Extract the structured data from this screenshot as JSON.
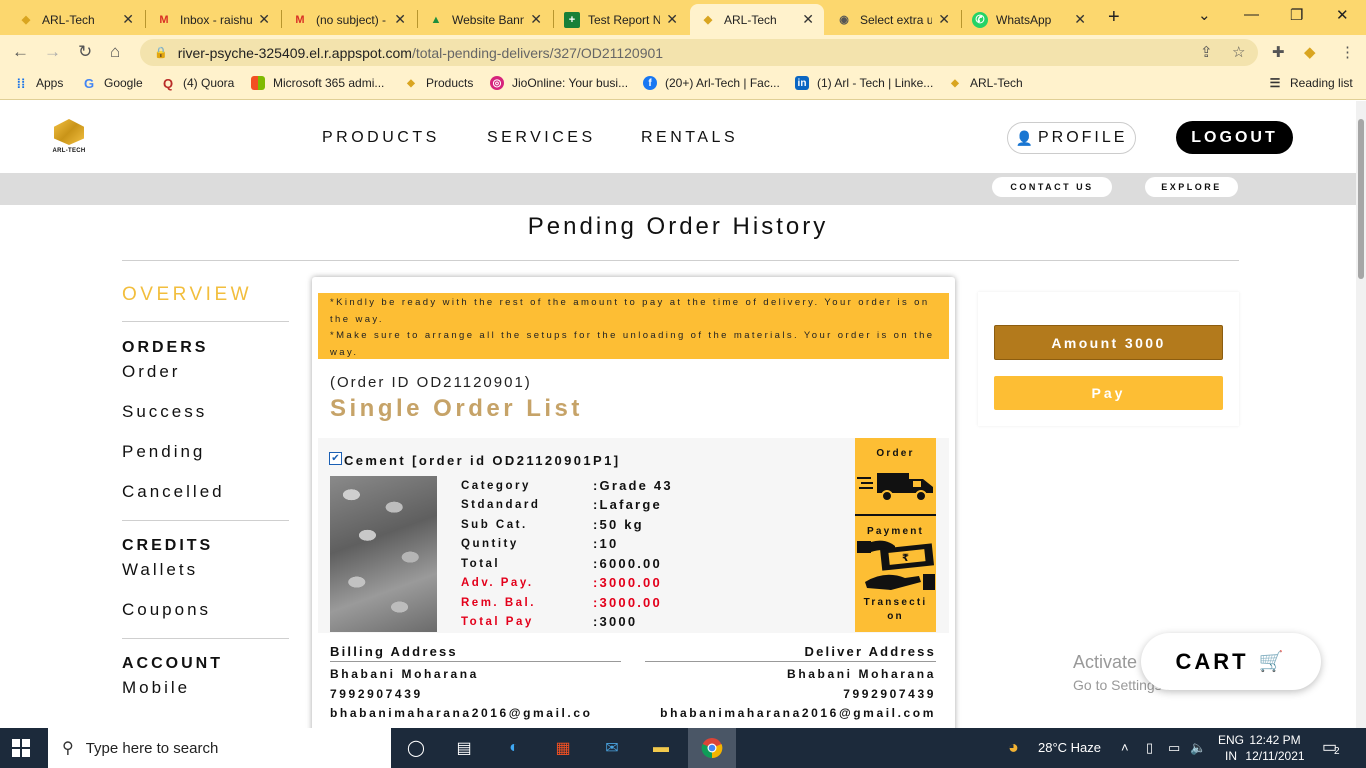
{
  "browser": {
    "tabs": [
      {
        "title": "ARL-Tech",
        "icon": "arl-logo-icon",
        "color": "#d9a520"
      },
      {
        "title": "Inbox - raishu",
        "icon": "gmail-icon",
        "color": "#d93025"
      },
      {
        "title": "(no subject) -",
        "icon": "gmail-icon",
        "color": "#d93025"
      },
      {
        "title": "Website Bann",
        "icon": "google-drive-icon",
        "color": "#1e8e3e"
      },
      {
        "title": "Test Report N",
        "icon": "google-sheets-icon",
        "color": "#188038"
      },
      {
        "title": "ARL-Tech",
        "icon": "arl-logo-icon",
        "color": "#d9a520",
        "active": true
      },
      {
        "title": "Select extra u",
        "icon": "globe-icon",
        "color": "#555555"
      },
      {
        "title": "WhatsApp",
        "icon": "whatsapp-icon",
        "color": "#25d366"
      }
    ],
    "url_host": "river-psyche-325409.el.r.appspot.com",
    "url_path": "/total-pending-delivers/327/OD21120901",
    "bookmarks": [
      {
        "label": "Apps",
        "icon": "apps-grid-icon"
      },
      {
        "label": "Google",
        "icon": "google-icon"
      },
      {
        "label": "(4) Quora",
        "icon": "quora-icon"
      },
      {
        "label": "Microsoft 365 admi...",
        "icon": "microsoft-icon"
      },
      {
        "label": "Products",
        "icon": "arl-logo-icon"
      },
      {
        "label": "JioOnline: Your busi...",
        "icon": "jio-icon"
      },
      {
        "label": "(20+) Arl-Tech | Fac...",
        "icon": "facebook-icon"
      },
      {
        "label": "(1) Arl - Tech | Linke...",
        "icon": "linkedin-icon"
      },
      {
        "label": "ARL-Tech",
        "icon": "arl-logo-icon"
      }
    ],
    "reading_list": "Reading list"
  },
  "site": {
    "logo_text": "ARL-TECH",
    "nav": [
      "PRODUCTS",
      "SERVICES",
      "RENTALS"
    ],
    "profile_label": "PROFILE",
    "logout_label": "LOGOUT",
    "contact_label": "CONTACT US",
    "explore_label": "EXPLORE"
  },
  "page": {
    "title": "Pending Order History"
  },
  "sidebar": {
    "overview": "OVERVIEW",
    "orders_heading": "ORDERS",
    "orders_items": [
      "Order",
      "Success",
      "Pending",
      "Cancelled"
    ],
    "credits_heading": "CREDITS",
    "credits_items": [
      "Wallets",
      "Coupons"
    ],
    "account_heading": "ACCOUNT",
    "account_items": [
      "Mobile"
    ]
  },
  "order": {
    "notice_1": "*Kindly be ready with the rest of the amount to pay at the time of delivery. Your order is on the way.",
    "notice_2": "*Make sure to arrange all the setups for the unloading of the materials. Your order is on the way.",
    "order_id_text": "(Order ID OD21120901)",
    "list_title": "Single Order List",
    "item": {
      "checked": true,
      "name": "Cement [order id OD21120901P1]",
      "specs": [
        {
          "label": "Category",
          "value": ":Grade 43",
          "highlight": false
        },
        {
          "label": "Stdandard",
          "value": ":Lafarge",
          "highlight": false
        },
        {
          "label": "Sub Cat.",
          "value": ":50 kg",
          "highlight": false
        },
        {
          "label": "Quntity",
          "value": ":10",
          "highlight": false
        },
        {
          "label": "Total",
          "value": ":6000.00",
          "highlight": false
        },
        {
          "label": "Adv. Pay.",
          "value": ":3000.00",
          "highlight": true
        },
        {
          "label": "Rem. Bal.",
          "value": ":3000.00",
          "highlight": true
        },
        {
          "label": "Total Pay",
          "value": ":3000",
          "highlight": true
        }
      ],
      "status_order": "Order",
      "status_payment": "Payment",
      "status_transection_1": "Transecti",
      "status_transection_2": "on"
    },
    "billing": {
      "heading": "Billing Address",
      "name": "Bhabani Moharana",
      "phone": "7992907439",
      "email": "bhabanimaharana2016@gmail.co"
    },
    "deliver": {
      "heading": "Deliver Address",
      "name": "Bhabani Moharana",
      "phone": "7992907439",
      "email": "bhabanimaharana2016@gmail.com"
    }
  },
  "payment": {
    "amount_label": "Amount 3000",
    "pay_label": "Pay"
  },
  "cart_label": "CART",
  "watermark": {
    "line1": "Activate Windows",
    "line2": "Go to Settings to activate Windows."
  },
  "taskbar": {
    "search_placeholder": "Type here to search",
    "weather": "28°C  Haze",
    "lang_1": "ENG",
    "lang_2": "IN",
    "time": "12:42 PM",
    "date": "12/11/2021",
    "notifications": "2"
  },
  "colors": {
    "brand_yellow": "#fdbe34",
    "brand_gold": "#c6a368",
    "amount_brown": "#b37a1c",
    "alert_red": "#e3001b",
    "browser_frame": "#fcd76e"
  }
}
